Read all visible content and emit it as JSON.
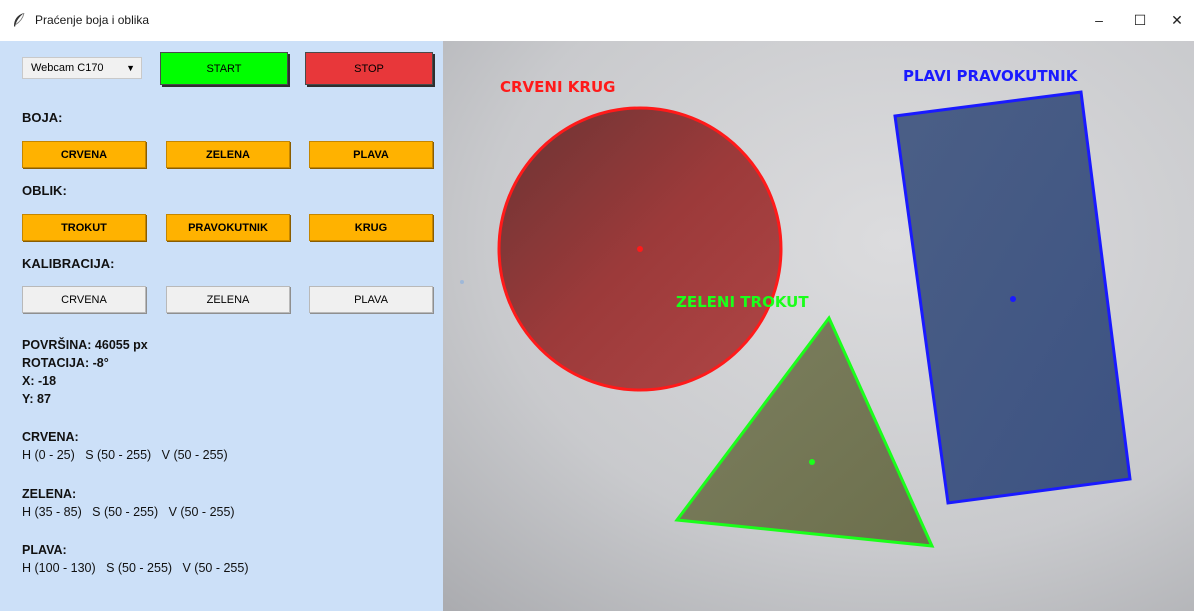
{
  "window": {
    "title": "Praćenje boja i oblika",
    "minimize": "–",
    "maximize": "☐",
    "close": "✕"
  },
  "controls": {
    "camera_select": "Webcam C170",
    "start_label": "START",
    "stop_label": "STOP"
  },
  "sections": {
    "color": "BOJA:",
    "shape": "OBLIK:",
    "calibration": "KALIBRACIJA:"
  },
  "color_buttons": [
    "CRVENA",
    "ZELENA",
    "PLAVA"
  ],
  "shape_buttons": [
    "TROKUT",
    "PRAVOKUTNIK",
    "KRUG"
  ],
  "calibration_buttons": [
    "CRVENA",
    "ZELENA",
    "PLAVA"
  ],
  "measurements": {
    "area": "POVRŠINA: 46055 px",
    "rotation": "ROTACIJA: -8°",
    "x": "X: -18",
    "y": "Y: 87"
  },
  "ranges": {
    "red_title": "CRVENA:",
    "red_values": "H (0 - 25)   S (50 - 255)   V (50 - 255)",
    "green_title": "ZELENA:",
    "green_values": "H (35 - 85)   S (50 - 255)   V (50 - 255)",
    "blue_title": "PLAVA:",
    "blue_values": "H (100 - 130)   S (50 - 255)   V (50 - 255)"
  },
  "detections": {
    "red_label": "CRVENI KRUG",
    "green_label": "ZELENI TROKUT",
    "blue_label": "PLAVI PRAVOKUTNIK"
  },
  "colors": {
    "panel_bg": "#cce0f8",
    "start": "#00ff00",
    "stop": "#e8373a",
    "selector_button": "#ffb200",
    "outline_red": "#ff1a1a",
    "outline_green": "#1aff1a",
    "outline_blue": "#1a1aff"
  }
}
